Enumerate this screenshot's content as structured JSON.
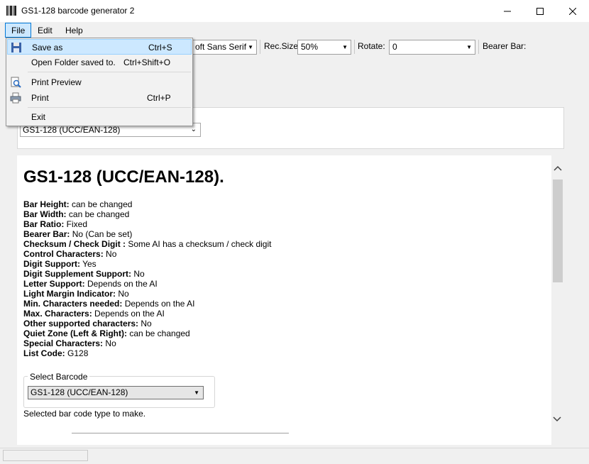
{
  "window": {
    "title": "GS1-128 barcode generator 2"
  },
  "menubar": {
    "file": "File",
    "edit": "Edit",
    "help": "Help"
  },
  "file_menu": {
    "items": [
      {
        "label": "Save as",
        "shortcut": "Ctrl+S",
        "icon": "save-icon"
      },
      {
        "label": "Open Folder saved to.",
        "shortcut": "Ctrl+Shift+O"
      },
      {
        "label": "Print Preview",
        "shortcut": "",
        "icon": "print-preview-icon"
      },
      {
        "label": "Print",
        "shortcut": "Ctrl+P",
        "icon": "printer-icon"
      },
      {
        "label": "Exit",
        "shortcut": ""
      }
    ]
  },
  "toolbar": {
    "font_value": "oft Sans Serif",
    "recsize_label": "Rec.Size",
    "recsize_value": "50%",
    "rotate_label": "Rotate:",
    "rotate_value": "0",
    "bearer_label": "Bearer Bar:"
  },
  "top_select": {
    "value": "GS1-128 (UCC/EAN-128)"
  },
  "content": {
    "heading": "GS1-128 (UCC/EAN-128).",
    "properties": [
      {
        "name": "Bar Height:",
        "value": " can be changed"
      },
      {
        "name": "Bar Width:",
        "value": " can be changed"
      },
      {
        "name": "Bar Ratio:",
        "value": " Fixed"
      },
      {
        "name": "Bearer Bar:",
        "value": " No (Can be set)"
      },
      {
        "name": "Checksum / Check Digit :",
        "value": " Some AI has a checksum / check digit"
      },
      {
        "name": "Control Characters:",
        "value": " No"
      },
      {
        "name": "Digit Support:",
        "value": " Yes"
      },
      {
        "name": "Digit Supplement Support:",
        "value": " No"
      },
      {
        "name": "Letter Support:",
        "value": " Depends on the AI"
      },
      {
        "name": "Light Margin Indicator:",
        "value": " No"
      },
      {
        "name": "Min. Characters needed:",
        "value": " Depends on the AI"
      },
      {
        "name": "Max. Characters:",
        "value": " Depends on the AI"
      },
      {
        "name": "Other supported characters:",
        "value": " No"
      },
      {
        "name": "Quiet Zone (Left & Right):",
        "value": " can be changed"
      },
      {
        "name": "Special Characters:",
        "value": " No"
      },
      {
        "name": "List Code:",
        "value": " G128"
      }
    ],
    "group_legend": "Select Barcode",
    "group_select_value": "GS1-128 (UCC/EAN-128)",
    "selected_text": "Selected bar code type to make."
  },
  "colors": {
    "highlight": "#cce8ff",
    "highlight_border": "#99d1ff",
    "accent": "#0078d7"
  }
}
